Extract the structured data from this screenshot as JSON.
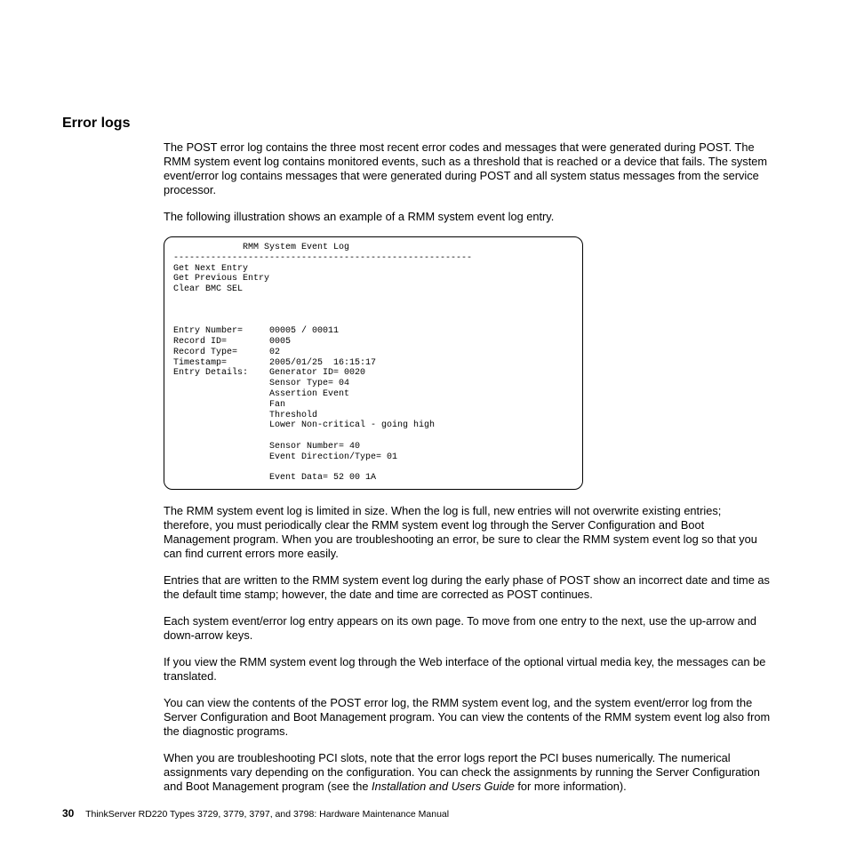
{
  "heading": "Error logs",
  "para1": "The POST error log contains the three most recent error codes and messages that were generated during POST. The RMM system event log contains monitored events, such as a threshold that is reached or a device that fails. The system event/error log contains messages that were generated during POST and all system status messages from the service processor.",
  "para2": "The following illustration shows an example of a RMM system event log entry.",
  "log": {
    "title": "RMM System Event Log",
    "rule": "--------------------------------------------------------",
    "cmds": [
      "Get Next Entry",
      "Get Previous Entry",
      "Clear BMC SEL"
    ],
    "fields": {
      "entry_number": "Entry Number=     00005 / 00011",
      "record_id": "Record ID=        0005",
      "record_type": "Record Type=      02",
      "timestamp": "Timestamp=        2005/01/25  16:15:17",
      "details_line": "Entry Details:    Generator ID= 0020",
      "sensor_type": "                  Sensor Type= 04",
      "assertion": "                  Assertion Event",
      "fan": "                  Fan",
      "threshold": "                  Threshold",
      "lower": "                  Lower Non-critical - going high",
      "sensor_num": "                  Sensor Number= 40",
      "evt_dir": "                  Event Direction/Type= 01",
      "evt_data": "                  Event Data= 52 00 1A"
    }
  },
  "para3": "The RMM system event log is limited in size. When the log is full, new entries will not overwrite existing entries; therefore, you must periodically clear the RMM system event log through the Server Configuration and Boot Management program. When you are troubleshooting an error, be sure to clear the RMM system event log so that you can find current errors more easily.",
  "para4": "Entries that are written to the RMM system event log during the early phase of POST show an incorrect date and time as the default time stamp; however, the date and time are corrected as POST continues.",
  "para5": "Each system event/error log entry appears on its own page. To move from one entry to the next, use the up-arrow and down-arrow keys.",
  "para6": "If you view the RMM system event log through the Web interface of the optional virtual media key, the messages can be translated.",
  "para7": "You can view the contents of the POST error log, the RMM system event log, and the system event/error log from the Server Configuration and Boot Management program. You can view the contents of the RMM system event log also from the diagnostic programs.",
  "para8a": "When you are troubleshooting PCI slots, note that the error logs report the PCI buses numerically. The numerical assignments vary depending on the configuration. You can check the assignments by running the Server Configuration and Boot Management program (see the ",
  "para8i": "Installation and Users Guide",
  "para8b": " for more information).",
  "footer": {
    "page": "30",
    "text": "ThinkServer RD220 Types 3729, 3779, 3797, and 3798: Hardware Maintenance Manual"
  }
}
